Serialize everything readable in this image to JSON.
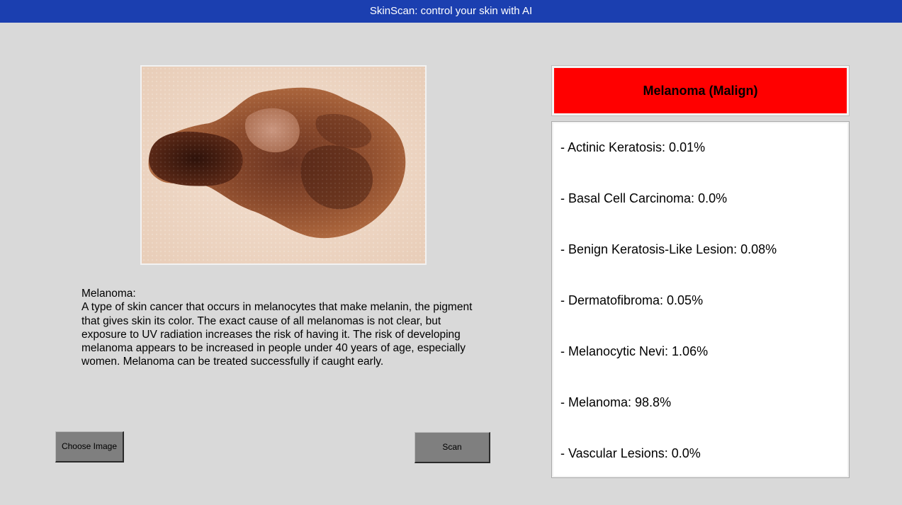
{
  "window": {
    "title": "SkinScan: control your skin with AI"
  },
  "image": {
    "icon": "skin-lesion-photo"
  },
  "description": {
    "heading": "Melanoma:",
    "body": "A type of skin cancer that occurs in melanocytes that make melanin, the pigment that gives skin its color. The exact cause of all melanomas is not clear, but exposure to UV radiation increases the risk of having it. The risk of developing melanoma appears to be increased in people under 40 years of age, especially women. Melanoma can be treated successfully if caught early."
  },
  "buttons": {
    "choose_label": "Choose Image",
    "scan_label": "Scan"
  },
  "result": {
    "label": "Melanoma (Malign)",
    "color": "#ff0000"
  },
  "probabilities": [
    "- Actinic Keratosis: 0.01%",
    "- Basal Cell Carcinoma: 0.0%",
    "- Benign Keratosis-Like Lesion: 0.08%",
    "- Dermatofibroma: 0.05%",
    "- Melanocytic Nevi: 1.06%",
    "- Melanoma: 98.8%",
    "- Vascular Lesions: 0.0%"
  ],
  "colors": {
    "title_bar": "#1b3fb0",
    "background": "#d9d9d9",
    "button": "#7f7f7f"
  }
}
